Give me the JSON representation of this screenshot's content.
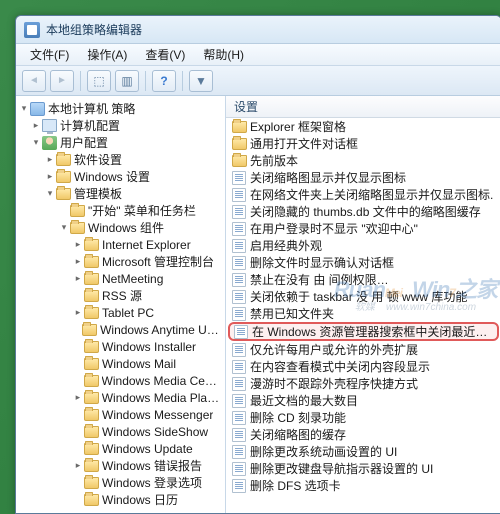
{
  "window": {
    "title": "本地组策略编辑器"
  },
  "menu": {
    "file": "文件(F)",
    "action": "操作(A)",
    "view": "查看(V)",
    "help": "帮助(H)"
  },
  "tree": {
    "root": "本地计算机 策略",
    "computer_config": "计算机配置",
    "user_config": "用户配置",
    "software_settings": "软件设置",
    "windows_settings": "Windows 设置",
    "admin_templates": "管理模板",
    "start_taskbar": "\"开始\" 菜单和任务栏",
    "windows_components": "Windows 组件",
    "ie": "Internet Explorer",
    "mmc": "Microsoft 管理控制台",
    "netmeeting": "NetMeeting",
    "rss": "RSS 源",
    "tablet": "Tablet PC",
    "anytime": "Windows Anytime Upgrade",
    "installer": "Windows Installer",
    "mail": "Windows Mail",
    "media_center": "Windows Media Center",
    "media_player": "Windows Media Player",
    "messenger": "Windows Messenger",
    "sideshow": "Windows SideShow",
    "update": "Windows Update",
    "error_report": "Windows 错误报告",
    "logon_options": "Windows 登录选项",
    "calendar": "Windows 日历"
  },
  "list_header": "设置",
  "settings": [
    "Explorer 框架窗格",
    "通用打开文件对话框",
    "先前版本",
    "关闭缩略图显示并仅显示图标",
    "在网络文件夹上关闭缩略图显示并仅显示图标.",
    "关闭隐藏的 thumbs.db 文件中的缩略图缓存",
    "在用户登录时不显示 \"欢迎中心\"",
    "启用经典外观",
    "删除文件时显示确认对话框",
    "禁止在没有 由 间例权限…",
    "关闭依赖于 taskbar 没 用 顿 www 库功能",
    "禁用已知文件夹",
    "在 Windows 资源管理器搜索框中关闭最近搜索条目的显示",
    "仅允许每用户或允许的外壳扩展",
    "在内容查看模式中关闭内容段显示",
    "漫游时不跟踪外壳程序快捷方式",
    "最近文档的最大数目",
    "删除 CD 刻录功能",
    "关闭缩略图的缓存",
    "删除更改系统动画设置的 UI",
    "删除更改键盘导航指示器设置的 UI",
    "删除 DFS 选项卡"
  ],
  "highlighted_index": 12
}
